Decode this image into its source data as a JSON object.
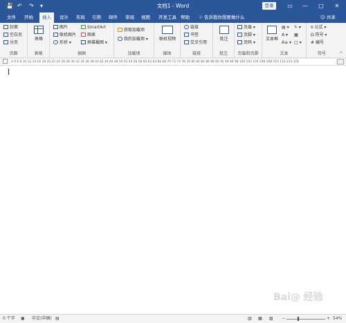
{
  "titlebar": {
    "title": "文档1 - Word",
    "login": "登录",
    "save_icon": "save-icon",
    "undo_glyph": "↶",
    "redo_glyph": "↷",
    "customize_glyph": "▾",
    "ribbon_display_glyph": "▭",
    "min_glyph": "—",
    "max_glyph": "□",
    "close_glyph": "✕"
  },
  "tabs": [
    {
      "label": "文件"
    },
    {
      "label": "开始"
    },
    {
      "label": "插入",
      "active": true
    },
    {
      "label": "设计"
    },
    {
      "label": "布局"
    },
    {
      "label": "引用"
    },
    {
      "label": "邮件"
    },
    {
      "label": "审阅"
    },
    {
      "label": "视图"
    },
    {
      "label": "开发工具"
    },
    {
      "label": "帮助"
    }
  ],
  "tell_me": "告诉我你想要做什么",
  "share": "共享",
  "ribbon": {
    "pages": {
      "label": "页面",
      "items": [
        "封面",
        "空白页",
        "分页"
      ]
    },
    "table": {
      "label": "表格",
      "button": "表格"
    },
    "illustrations": {
      "label": "插图",
      "items": [
        "图片",
        "联机图片",
        "形状",
        "SmartArt",
        "图表",
        "屏幕截图"
      ]
    },
    "addins": {
      "label": "加载项",
      "items": [
        "获取加载项",
        "我的加载项"
      ]
    },
    "media": {
      "label": "媒体",
      "button": "联机视频"
    },
    "links": {
      "label": "链接",
      "items": [
        "链接",
        "书签",
        "交叉引用"
      ]
    },
    "comments": {
      "label": "批注",
      "button": "批注"
    },
    "header_footer": {
      "label": "页眉和页脚",
      "items": [
        "页眉",
        "页脚",
        "页码"
      ]
    },
    "text": {
      "label": "文本",
      "button": "文本框"
    },
    "symbols": {
      "label": "符号",
      "items": [
        "公式",
        "符号",
        "编号"
      ]
    }
  },
  "ruler": {
    "left_label": "2",
    "ticks": "2 4 6 8 10 12 14 16 18 20 22 24 26 28 30 32 34 36 38 40 42 44 46 48 50 52 54 56 58 60 62 64 66 68 70 72 74 76 78 80 82 84 86 88 90 92 94 96 98 100 102 104 106 108 110 112 114 116"
  },
  "status": {
    "word_count": "0 个字",
    "language": "中文(中国)",
    "zoom": "54%",
    "minus": "−",
    "plus": "+"
  },
  "watermark": "Bai@ 经验",
  "colors": {
    "brand": "#2b579a",
    "ribbon_bg": "#f3f3f3"
  }
}
